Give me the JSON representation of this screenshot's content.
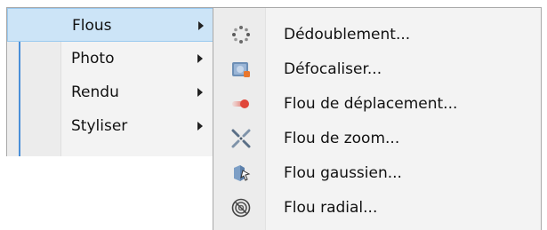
{
  "parent_menu": {
    "items": [
      {
        "label": "Flous",
        "selected": true
      },
      {
        "label": "Photo",
        "selected": false
      },
      {
        "label": "Rendu",
        "selected": false
      },
      {
        "label": "Styliser",
        "selected": false
      }
    ]
  },
  "submenu": {
    "items": [
      {
        "label": "Dédoublement...",
        "icon": "dots-ring-icon"
      },
      {
        "label": "Défocaliser...",
        "icon": "defocus-icon"
      },
      {
        "label": "Flou de déplacement...",
        "icon": "motion-blur-icon"
      },
      {
        "label": "Flou de zoom...",
        "icon": "zoom-blur-icon"
      },
      {
        "label": "Flou gaussien...",
        "icon": "gaussian-blur-icon"
      },
      {
        "label": "Flou radial...",
        "icon": "radial-blur-icon"
      }
    ]
  },
  "colors": {
    "selection_fill": "#cce4f7",
    "selection_border": "#99c9ef",
    "menu_background": "#f3f3f3",
    "accent_line": "#4a8fd8"
  }
}
